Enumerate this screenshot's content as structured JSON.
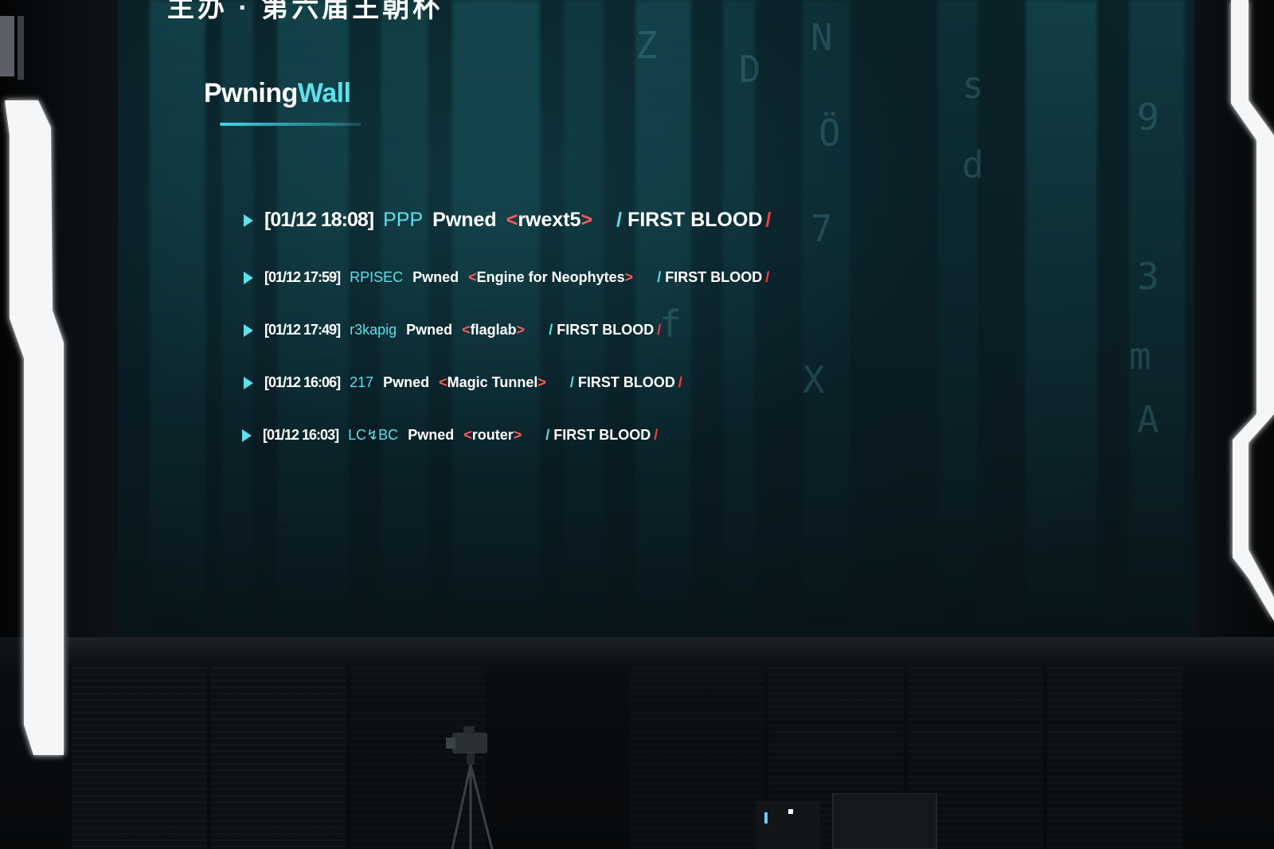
{
  "header": {
    "cut_text": "主办 · 第六届王朝杯"
  },
  "title": {
    "prefix": "Pwning",
    "accent": "Wall"
  },
  "events": [
    {
      "timestamp": "[01/12 18:08]",
      "team": "PPP",
      "verb": "Pwned",
      "challenge": "rwext5",
      "blood": "FIRST BLOOD"
    },
    {
      "timestamp": "[01/12 17:59]",
      "team": "RPISEC",
      "verb": "Pwned",
      "challenge": "Engine for Neophytes",
      "blood": "FIRST BLOOD"
    },
    {
      "timestamp": "[01/12 17:49]",
      "team": "r3kapig",
      "verb": "Pwned",
      "challenge": "flaglab",
      "blood": "FIRST BLOOD"
    },
    {
      "timestamp": "[01/12 16:06]",
      "team": "217",
      "verb": "Pwned",
      "challenge": "Magic Tunnel",
      "blood": "FIRST BLOOD"
    },
    {
      "timestamp": "[01/12 16:03]",
      "team": "LC↯BC",
      "verb": "Pwned",
      "challenge": "router",
      "blood": "FIRST BLOOD"
    }
  ],
  "colors": {
    "accent_cyan": "#5ee0ec",
    "accent_red": "#ff3b3b",
    "text_white": "#ffffff",
    "screen_bg": "#0a1c22"
  },
  "icons": {
    "row_marker": "play-triangle-icon"
  }
}
